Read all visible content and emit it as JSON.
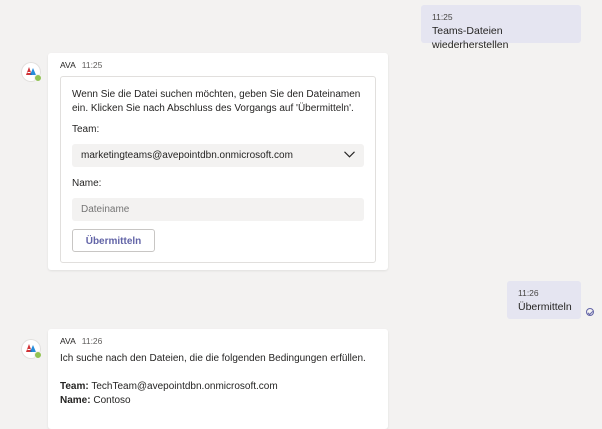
{
  "messages_out": [
    {
      "time": "11:25",
      "text": "Teams-Dateien wiederherstellen"
    },
    {
      "time": "11:26",
      "text": "Übermitteln"
    }
  ],
  "bot": {
    "name": "AVA"
  },
  "card_message": {
    "time": "11:25",
    "description": "Wenn Sie die Datei suchen möchten, geben Sie den Dateinamen ein. Klicken Sie nach Abschluss des Vorgangs auf 'Übermitteln'.",
    "team_label": "Team:",
    "team_value": "marketingteams@avepointdbn.onmicrosoft.com",
    "name_label": "Name:",
    "name_placeholder": "Dateiname",
    "submit_label": "Übermitteln"
  },
  "result_message": {
    "time": "11:26",
    "text": "Ich suche nach den Dateien, die die folgenden Bedingungen erfüllen.",
    "team_key": "Team:",
    "team_value": "TechTeam@avepointdbn.onmicrosoft.com",
    "name_key": "Name:",
    "name_value": "Contoso"
  },
  "icons": {
    "avatar": "ava-bot-logo",
    "presence": "available-status",
    "dropdown": "chevron-down-icon",
    "seen": "read-receipt-icon"
  },
  "colors": {
    "accent": "#6264a7",
    "presence": "#92c353",
    "out_bubble": "#e5e5f1"
  }
}
